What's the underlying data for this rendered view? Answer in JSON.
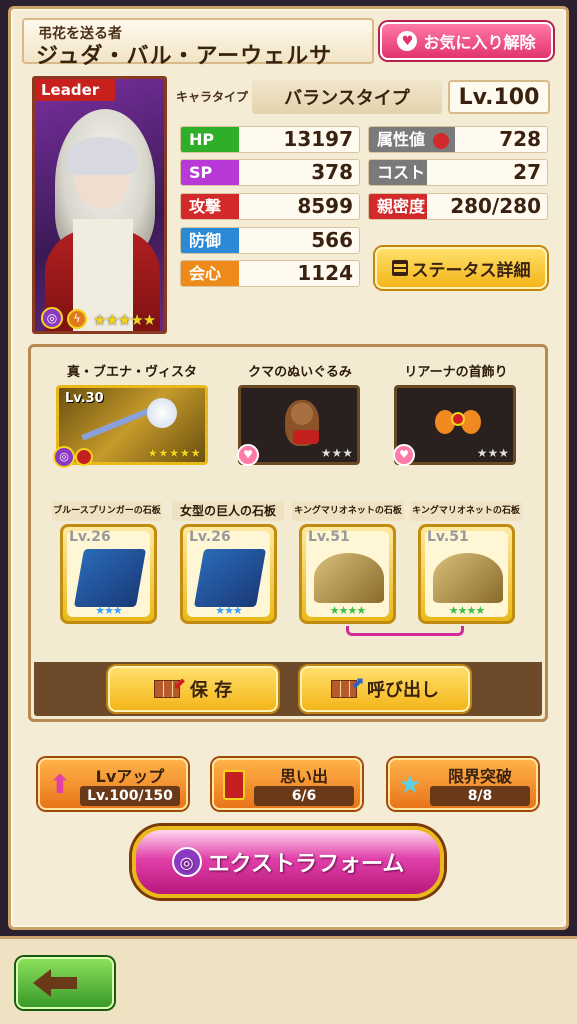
{
  "header": {
    "subtitle": "弔花を送る者",
    "name": "ジュダ・バル・アーウェルサ",
    "favorite_button": "お気に入り解除"
  },
  "portrait": {
    "leader_tag": "Leader",
    "rarity_stars": "★★★★★"
  },
  "character": {
    "type_label": "キャラタイプ",
    "type_value": "バランスタイプ",
    "level": "Lv.100"
  },
  "stats": {
    "hp": {
      "label": "HP",
      "value": "13197"
    },
    "sp": {
      "label": "SP",
      "value": "378"
    },
    "attack": {
      "label": "攻撃",
      "value": "8599"
    },
    "defense": {
      "label": "防御",
      "value": "566"
    },
    "crit": {
      "label": "会心",
      "value": "1124"
    },
    "attribute": {
      "label": "属性値",
      "value": "728"
    },
    "cost": {
      "label": "コスト",
      "value": "27"
    },
    "affinity": {
      "label": "親密度",
      "value": "280/280"
    }
  },
  "status_details_button": "ステータス詳細",
  "equipment": [
    {
      "name": "真・ブエナ・ヴィスタ",
      "level": "Lv.30",
      "stars": "★★★★★"
    },
    {
      "name": "クマのぬいぐるみ",
      "stars": "★★★"
    },
    {
      "name": "リアーナの首飾り",
      "stars": "★★★"
    }
  ],
  "slabs": [
    {
      "name": "ブルースプリンガーの石板",
      "level": "Lv.26",
      "stars": "★★★"
    },
    {
      "name": "女型の巨人の石板",
      "level": "Lv.26",
      "stars": "★★★"
    },
    {
      "name": "キングマリオネットの石板",
      "level": "Lv.51",
      "stars": "★★★★"
    },
    {
      "name": "キングマリオネットの石板",
      "level": "Lv.51",
      "stars": "★★★★"
    }
  ],
  "buttons": {
    "save": "保 存",
    "recall": "呼び出し",
    "lvup_label": "Lvアップ",
    "lvup_value": "Lv.100/150",
    "memory_label": "思い出",
    "memory_value": "6/6",
    "limit_label": "限界突破",
    "limit_value": "8/8",
    "extra_form": "エクストラフォーム"
  },
  "colors": {
    "hp": "#2fae2a",
    "sp": "#b838d8",
    "attack": "#d22a2a",
    "defense": "#2a8ad8",
    "crit": "#ee8a1a",
    "gray_label": "#7a7a7a"
  }
}
